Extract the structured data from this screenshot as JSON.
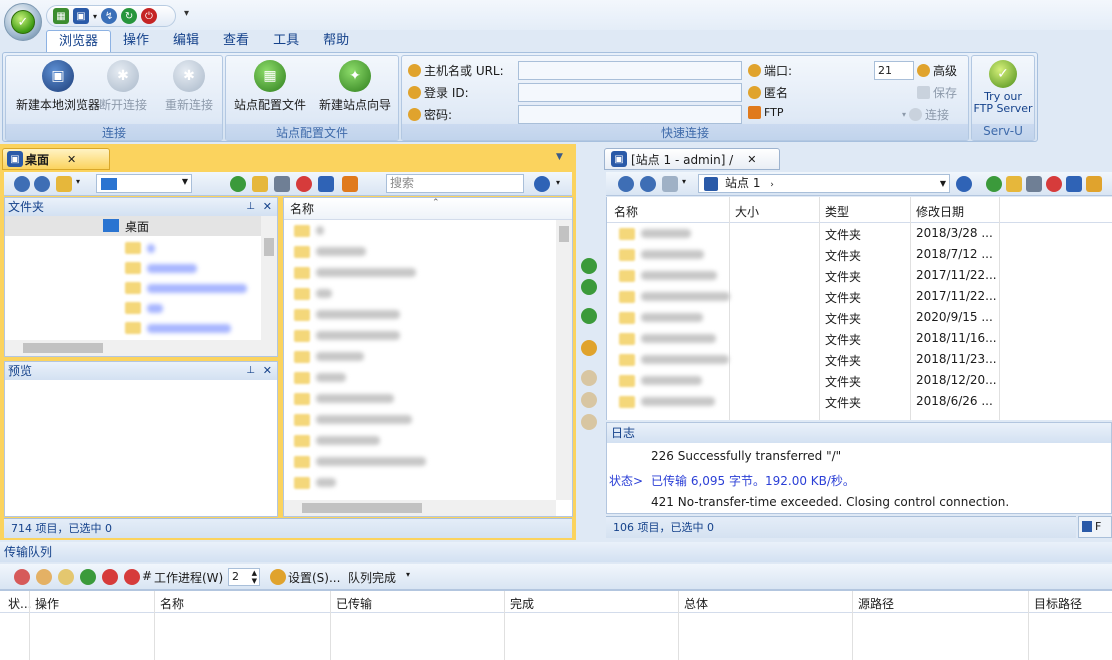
{
  "ribbon": {
    "tabs": [
      "浏览器",
      "操作",
      "编辑",
      "查看",
      "工具",
      "帮助"
    ],
    "connect_group": {
      "title": "连接",
      "new_local_browser": "新建本地浏览器",
      "disconnect": "断开连接",
      "reconnect": "重新连接"
    },
    "site_group": {
      "title": "站点配置文件",
      "site_profile": "站点配置文件",
      "new_site_wizard": "新建站点向导"
    },
    "quick_connect": {
      "title": "快速连接",
      "host_label": "主机名或 URL:",
      "login_label": "登录 ID:",
      "password_label": "密码:",
      "port_label": "端口:",
      "port_value": "21",
      "anonymous_label": "匿名",
      "ftp_label": "FTP",
      "advanced_label": "高级",
      "save_label": "保存",
      "connect_label": "连接"
    },
    "servu": {
      "line1": "Try our",
      "line2": "FTP Server",
      "title": "Serv-U"
    }
  },
  "left": {
    "tab_label": "桌面",
    "search_placeholder": "搜索",
    "folder_pane_title": "文件夹",
    "desktop_node": "桌面",
    "preview_title": "预览",
    "name_header": "名称",
    "status": "714 项目，已选中 0"
  },
  "right": {
    "tab_label": "[站点 1 - admin] /",
    "path": "站点 1",
    "headers": [
      "名称",
      "大小",
      "类型",
      "修改日期"
    ],
    "rows": [
      {
        "type": "文件夹",
        "date": "2018/3/28 ..."
      },
      {
        "type": "文件夹",
        "date": "2018/7/12 ..."
      },
      {
        "type": "文件夹",
        "date": "2017/11/22..."
      },
      {
        "type": "文件夹",
        "date": "2017/11/22..."
      },
      {
        "type": "文件夹",
        "date": "2020/9/15 ..."
      },
      {
        "type": "文件夹",
        "date": "2018/11/16..."
      },
      {
        "type": "文件夹",
        "date": "2018/11/23..."
      },
      {
        "type": "文件夹",
        "date": "2018/12/20..."
      },
      {
        "type": "文件夹",
        "date": "2018/6/26 ..."
      }
    ],
    "log_title": "日志",
    "log": [
      {
        "prefix": "",
        "text": "226 Successfully transferred \"/\""
      },
      {
        "prefix": "状态>",
        "text": "已传输 6,095 字节。192.00 KB/秒。"
      },
      {
        "prefix": "",
        "text": "421 No-transfer-time exceeded. Closing control connection."
      }
    ],
    "status": "106 项目，已选中 0",
    "status_extra": "F"
  },
  "queue": {
    "title": "传输队列",
    "workers_label": "工作进程(W)",
    "workers_value": "2",
    "settings_label": "设置(S)...",
    "queue_done_label": "队列完成",
    "headers": [
      "状...",
      "操作",
      "名称",
      "已传输",
      "完成",
      "总体",
      "源路径",
      "目标路径"
    ]
  },
  "colors": {
    "accent": "#15428b",
    "tab_active": "#fbd35e",
    "status_blue": "#2b3fd6"
  }
}
